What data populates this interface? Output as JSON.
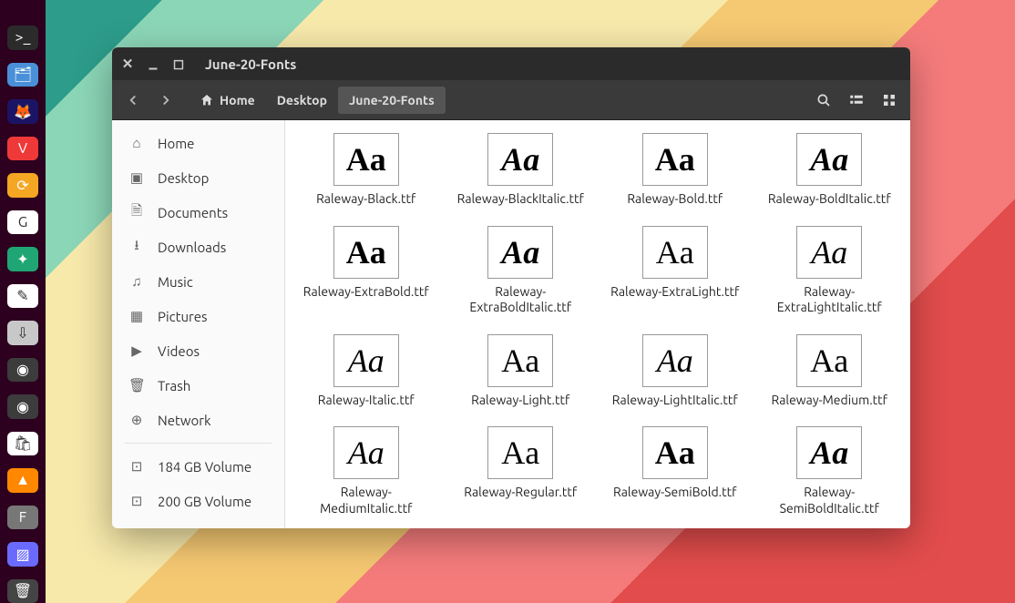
{
  "window": {
    "title": "June-20-Fonts"
  },
  "breadcrumbs": [
    {
      "label": "Home",
      "icon": "home"
    },
    {
      "label": "Desktop"
    },
    {
      "label": "June-20-Fonts",
      "active": true
    }
  ],
  "sidebar": {
    "places": [
      {
        "label": "Home",
        "icon": "⌂"
      },
      {
        "label": "Desktop",
        "icon": "▣"
      },
      {
        "label": "Documents",
        "icon": "🗎"
      },
      {
        "label": "Downloads",
        "icon": "⭳"
      },
      {
        "label": "Music",
        "icon": "♫"
      },
      {
        "label": "Pictures",
        "icon": "▦"
      },
      {
        "label": "Videos",
        "icon": "▶"
      },
      {
        "label": "Trash",
        "icon": "🗑"
      },
      {
        "label": "Network",
        "icon": "⊕"
      }
    ],
    "devices": [
      {
        "label": "184 GB Volume",
        "icon": "⊡"
      },
      {
        "label": "200 GB Volume",
        "icon": "⊡"
      }
    ]
  },
  "files": [
    {
      "name": "Raleway-Black.ttf",
      "weight": 900,
      "italic": false
    },
    {
      "name": "Raleway-BlackItalic.ttf",
      "weight": 900,
      "italic": true
    },
    {
      "name": "Raleway-Bold.ttf",
      "weight": 700,
      "italic": false
    },
    {
      "name": "Raleway-BoldItalic.ttf",
      "weight": 700,
      "italic": true
    },
    {
      "name": "Raleway-ExtraBold.ttf",
      "weight": 800,
      "italic": false
    },
    {
      "name": "Raleway-ExtraBoldItalic.ttf",
      "weight": 800,
      "italic": true
    },
    {
      "name": "Raleway-ExtraLight.ttf",
      "weight": 200,
      "italic": false
    },
    {
      "name": "Raleway-ExtraLightItalic.ttf",
      "weight": 200,
      "italic": true
    },
    {
      "name": "Raleway-Italic.ttf",
      "weight": 400,
      "italic": true
    },
    {
      "name": "Raleway-Light.ttf",
      "weight": 300,
      "italic": false
    },
    {
      "name": "Raleway-LightItalic.ttf",
      "weight": 300,
      "italic": true
    },
    {
      "name": "Raleway-Medium.ttf",
      "weight": 500,
      "italic": false
    },
    {
      "name": "Raleway-MediumItalic.ttf",
      "weight": 500,
      "italic": true
    },
    {
      "name": "Raleway-Regular.ttf",
      "weight": 400,
      "italic": false
    },
    {
      "name": "Raleway-SemiBold.ttf",
      "weight": 600,
      "italic": false
    },
    {
      "name": "Raleway-SemiBoldItalic.ttf",
      "weight": 600,
      "italic": true
    }
  ],
  "dock": [
    {
      "name": "terminal",
      "glyph": ">_",
      "bg": "#2b2b2b"
    },
    {
      "name": "files",
      "glyph": "🗂",
      "bg": "#4a90d9"
    },
    {
      "name": "firefox",
      "glyph": "🦊",
      "bg": "#1b1464"
    },
    {
      "name": "vivaldi",
      "glyph": "V",
      "bg": "#ef3939"
    },
    {
      "name": "sync",
      "glyph": "⟳",
      "bg": "#f5a623"
    },
    {
      "name": "google",
      "glyph": "G",
      "bg": "#ffffff"
    },
    {
      "name": "tweaks",
      "glyph": "✦",
      "bg": "#20a674"
    },
    {
      "name": "notes",
      "glyph": "✎",
      "bg": "#ffffff"
    },
    {
      "name": "archive",
      "glyph": "⇩",
      "bg": "#c8c8c8"
    },
    {
      "name": "podcast-1",
      "glyph": "◉",
      "bg": "#3c3c3c"
    },
    {
      "name": "podcast-2",
      "glyph": "◉",
      "bg": "#3c3c3c"
    },
    {
      "name": "software",
      "glyph": "🛍",
      "bg": "#ffffff"
    },
    {
      "name": "vlc",
      "glyph": "▲",
      "bg": "#ff8800"
    },
    {
      "name": "font-manager",
      "glyph": "F",
      "bg": "#777777"
    },
    {
      "name": "screenshot",
      "glyph": "▨",
      "bg": "#6a6aff"
    },
    {
      "name": "trash",
      "glyph": "🗑",
      "bg": "#444444"
    }
  ]
}
